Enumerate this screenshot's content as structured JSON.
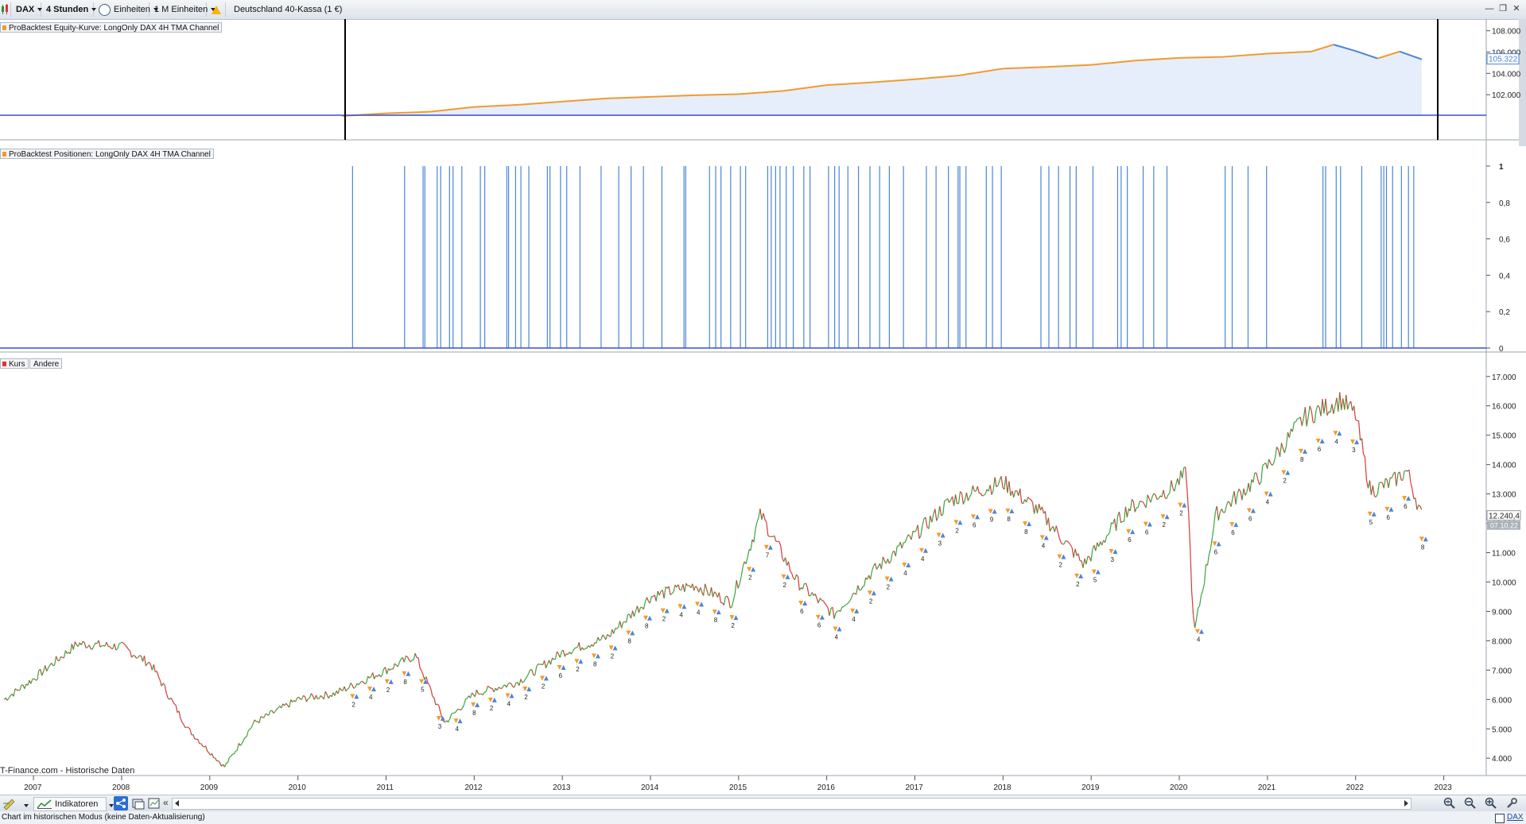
{
  "toolbar": {
    "symbol": "DAX",
    "timeframe": "4 Stunden",
    "units": "Einheiten",
    "history": "1 M Einheiten",
    "instrument": "Deutschland 40-Kassa (1 €)"
  },
  "window_controls": {
    "minimize": "—",
    "restore": "❐",
    "close": "✕"
  },
  "panels": {
    "equity": {
      "label": "ProBacktest Equity-Kurve: LongOnly DAX 4H TMA Channel",
      "ticks": [
        "108.000",
        "106.000",
        "104.000",
        "102.000"
      ],
      "current_value": "105.322",
      "colors": {
        "line_up": "#f29a2e",
        "line_down": "#4a86d6",
        "fill": "#e6eefc"
      }
    },
    "positions": {
      "label": "ProBacktest Positionen: LongOnly DAX 4H TMA Channel",
      "ticks": [
        "1",
        "0,8",
        "0,6",
        "0,4",
        "0,2",
        "0"
      ],
      "color": "#4a86d6"
    },
    "price": {
      "legend": [
        "Kurs",
        "Andere"
      ],
      "ticks": [
        "17.000",
        "16.000",
        "15.000",
        "14.000",
        "13.000",
        "12.000",
        "11.000",
        "10.000",
        "9.000",
        "8.000",
        "7.000",
        "6.000",
        "5.000",
        "4.000"
      ],
      "last_price": "12.240,4",
      "last_date": "07.10.22",
      "source": "T-Finance.com - Historische Daten",
      "trade_labels": [
        "2",
        "4",
        "2",
        "8",
        "5",
        "3",
        "4",
        "8",
        "2",
        "4",
        "2",
        "2",
        "6",
        "2",
        "8",
        "2",
        "8",
        "8",
        "2",
        "4",
        "4",
        "8",
        "2",
        "2",
        "7",
        "2",
        "6",
        "6",
        "4",
        "4",
        "2",
        "2",
        "4",
        "4",
        "3",
        "2",
        "6",
        "9",
        "8",
        "8",
        "4",
        "2",
        "2",
        "5",
        "3",
        "6",
        "6",
        "2",
        "2",
        "4",
        "6",
        "6",
        "6",
        "4",
        "2",
        "8",
        "6",
        "4",
        "3",
        "5",
        "6",
        "6",
        "8"
      ]
    },
    "years": [
      "2007",
      "2008",
      "2009",
      "2010",
      "2011",
      "2012",
      "2013",
      "2014",
      "2015",
      "2016",
      "2017",
      "2018",
      "2019",
      "2020",
      "2021",
      "2022",
      "2023"
    ]
  },
  "chart_data": [
    {
      "type": "line",
      "title": "ProBacktest Equity-Kurve: LongOnly DAX 4H TMA Channel",
      "x": [
        "2010-07",
        "2011-01",
        "2011-07",
        "2012-01",
        "2012-07",
        "2013-01",
        "2013-07",
        "2014-01",
        "2014-07",
        "2015-01",
        "2015-07",
        "2016-01",
        "2016-07",
        "2017-01",
        "2017-07",
        "2018-01",
        "2018-07",
        "2019-01",
        "2019-07",
        "2020-01",
        "2020-07",
        "2021-01",
        "2021-07",
        "2021-10",
        "2022-01",
        "2022-04",
        "2022-07",
        "2022-10"
      ],
      "values": [
        100000,
        100250,
        100400,
        100850,
        101050,
        101350,
        101650,
        101800,
        101950,
        102050,
        102350,
        102900,
        103150,
        103450,
        103800,
        104450,
        104600,
        104800,
        105200,
        105450,
        105550,
        105850,
        106050,
        106700,
        106100,
        105400,
        106050,
        105322
      ],
      "ylabel": "",
      "ylim": [
        100000,
        108500
      ]
    },
    {
      "type": "bar",
      "title": "ProBacktest Positionen: LongOnly DAX 4H TMA Channel",
      "series": [
        {
          "values": [
            2010.62,
            2011.21,
            2011.42,
            2011.44,
            2011.58,
            2011.62,
            2011.72,
            2011.76,
            2011.86,
            2012.07,
            2012.12,
            2012.37,
            2012.39,
            2012.47,
            2012.53,
            2012.62,
            2012.83,
            2012.86,
            2012.98,
            2013.05,
            2013.2,
            2013.44,
            2013.64,
            2013.78,
            2013.92,
            2014.13,
            2014.38,
            2014.4,
            2014.67,
            2014.74,
            2014.8,
            2014.91,
            2015.02,
            2015.08,
            2015.33,
            2015.37,
            2015.42,
            2015.47,
            2015.54,
            2015.62,
            2015.74,
            2015.81,
            2016.02,
            2016.09,
            2016.14,
            2016.24,
            2016.36,
            2016.49,
            2016.6,
            2016.71,
            2016.87,
            2017.13,
            2017.24,
            2017.38,
            2017.49,
            2017.51,
            2017.58,
            2017.81,
            2017.88,
            2017.98,
            2018.43,
            2018.52,
            2018.63,
            2018.76,
            2018.83,
            2019.02,
            2019.3,
            2019.34,
            2019.41,
            2019.59,
            2019.71,
            2019.86,
            2020.52,
            2020.6,
            2020.78,
            2020.99,
            2021.63,
            2021.66,
            2021.78,
            2021.83,
            2022.07,
            2022.29,
            2022.32,
            2022.35,
            2022.42,
            2022.52,
            2022.6,
            2022.66
          ]
        }
      ],
      "ylim": [
        0,
        1
      ]
    },
    {
      "type": "line",
      "title": "Kurs",
      "x": [
        "2006-09",
        "2007-01",
        "2007-07",
        "2008-01",
        "2008-05",
        "2008-10",
        "2009-03",
        "2009-07",
        "2010-01",
        "2010-06",
        "2011-01",
        "2011-05",
        "2011-09",
        "2012-01",
        "2012-07",
        "2013-01",
        "2013-07",
        "2014-01",
        "2014-07",
        "2014-12",
        "2015-04",
        "2015-09",
        "2016-02",
        "2016-07",
        "2017-01",
        "2017-06",
        "2018-01",
        "2018-06",
        "2018-12",
        "2019-06",
        "2019-12",
        "2020-02",
        "2020-03",
        "2020-06",
        "2020-12",
        "2021-06",
        "2021-11",
        "2022-01",
        "2022-03",
        "2022-06",
        "2022-08",
        "2022-10"
      ],
      "values": [
        6000,
        6700,
        7900,
        7800,
        7200,
        5000,
        3700,
        5200,
        6000,
        6200,
        7000,
        7500,
        5200,
        6200,
        6600,
        7600,
        8100,
        9500,
        9900,
        9300,
        12300,
        10000,
        8900,
        10300,
        11600,
        12800,
        13400,
        12400,
        10600,
        12500,
        13200,
        13700,
        8200,
        12300,
        13600,
        15600,
        16200,
        15700,
        13100,
        13400,
        13800,
        12240
      ],
      "ylim": [
        3600,
        17400
      ]
    }
  ],
  "bottom_toolbar": {
    "indicators": "Indikatoren"
  },
  "status": {
    "message": "Chart im historischen Modus (keine Daten-Aktualisierung)",
    "ticker": "DAX"
  }
}
